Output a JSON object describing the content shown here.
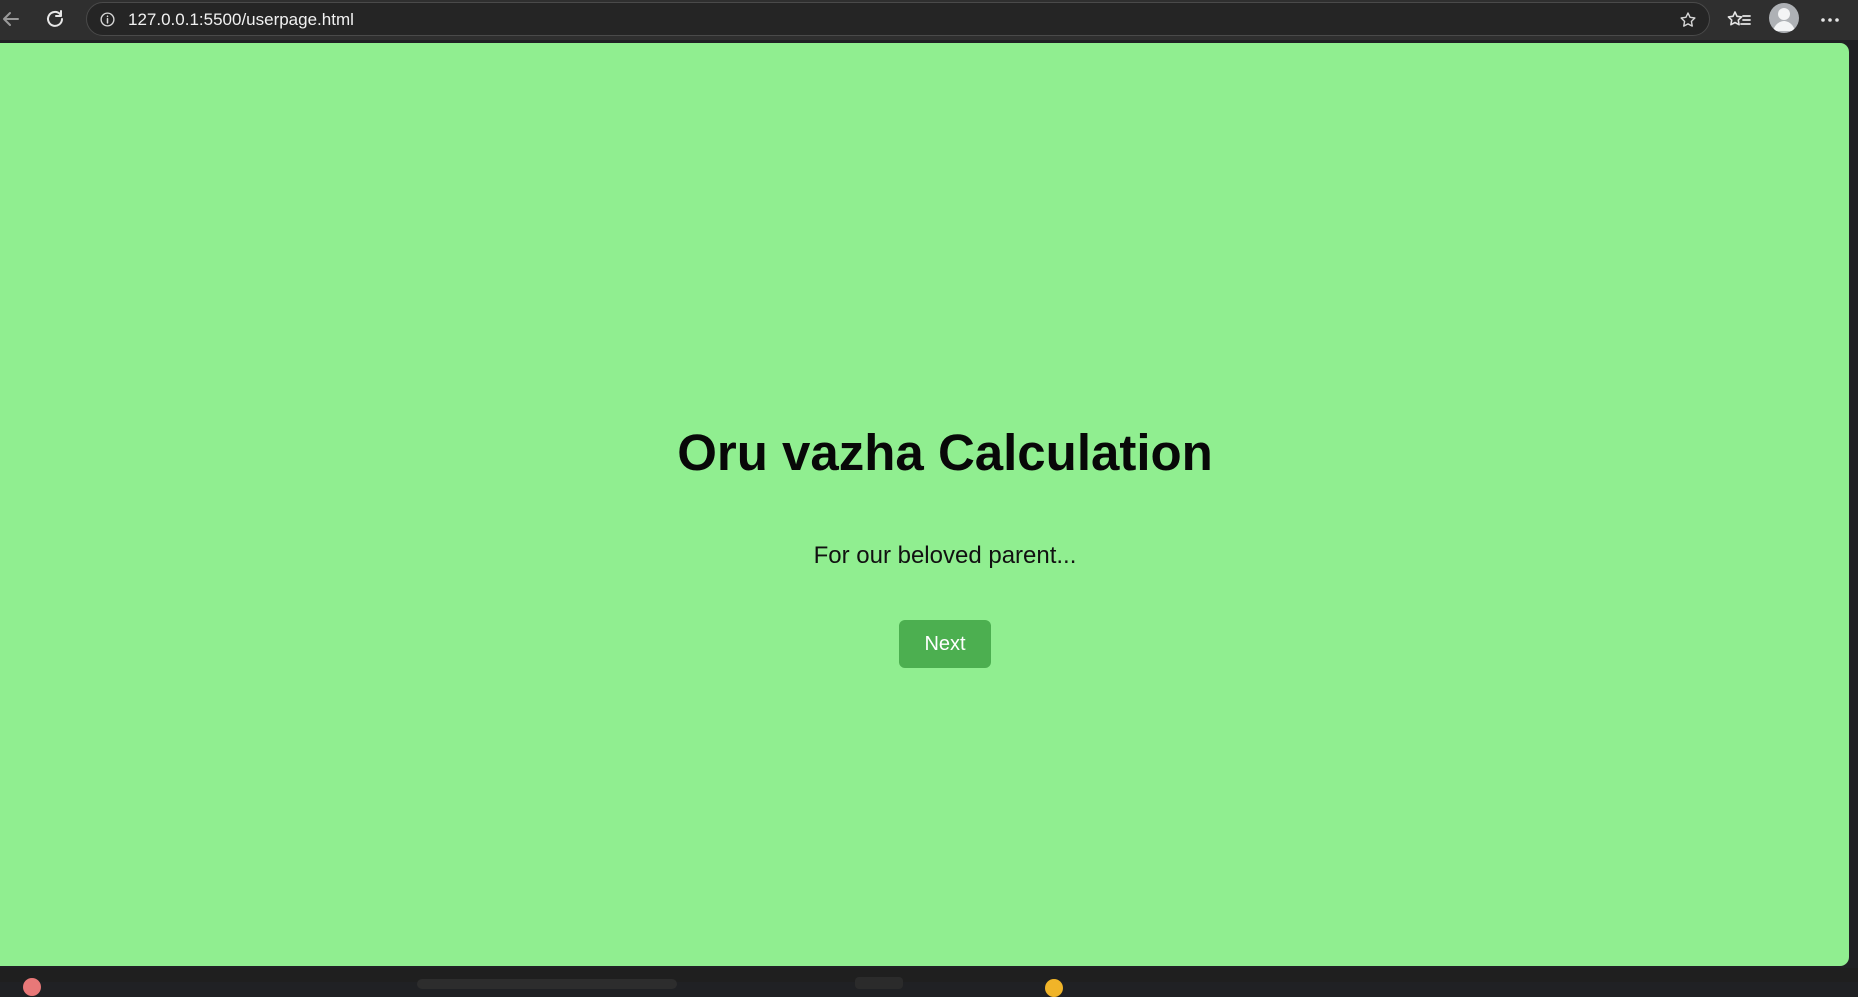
{
  "browser": {
    "url": "127.0.0.1:5500/userpage.html",
    "icons": {
      "back": "arrow-left-icon",
      "reload": "reload-icon",
      "site_info": "info-icon",
      "favorite": "star-icon",
      "favorites_collection": "favorites-icon",
      "profile": "avatar-icon",
      "menu": "more-icon"
    }
  },
  "page": {
    "background_color": "#90ee90",
    "title": "Oru vazha Calculation",
    "subtitle": "For our beloved parent...",
    "next_button": {
      "label": "Next",
      "color": "#4caf50",
      "text_color": "#ffffff"
    }
  }
}
